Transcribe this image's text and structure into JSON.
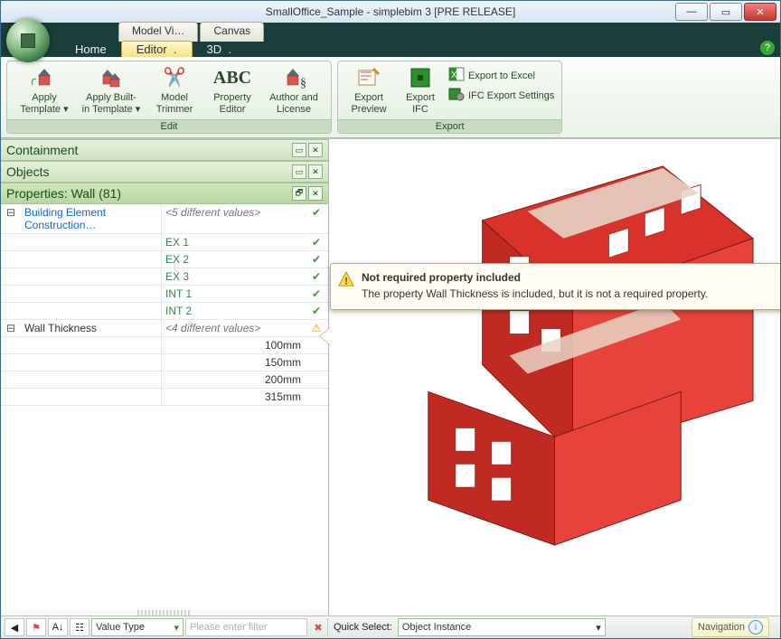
{
  "window": {
    "title": "SmallOffice_Sample - simplebim 3 [PRE RELEASE]"
  },
  "context_tabs": {
    "items": [
      "Model Vi…",
      "Canvas"
    ]
  },
  "main_tabs": {
    "items": [
      "Home",
      "Editor",
      "3D"
    ],
    "active": "Editor"
  },
  "ribbon": {
    "groups": [
      {
        "name": "Edit",
        "items": [
          {
            "label1": "Apply",
            "label2": "Template ▾",
            "icon": "apply-template-icon"
          },
          {
            "label1": "Apply Built-",
            "label2": "in Template ▾",
            "icon": "apply-builtin-template-icon"
          },
          {
            "label1": "Model",
            "label2": "Trimmer",
            "icon": "scissors-icon"
          },
          {
            "label1": "Property",
            "label2": "Editor",
            "icon": "property-editor-icon"
          },
          {
            "label1": "Author and",
            "label2": "License",
            "icon": "author-license-icon"
          }
        ]
      },
      {
        "name": "Export",
        "items": [
          {
            "label1": "Export",
            "label2": "Preview",
            "icon": "export-preview-icon"
          },
          {
            "label1": "Export",
            "label2": "IFC",
            "icon": "export-ifc-icon"
          }
        ],
        "small_items": [
          {
            "label": "Export to Excel",
            "icon": "excel-icon"
          },
          {
            "label": "IFC Export Settings",
            "icon": "ifc-settings-icon"
          }
        ]
      }
    ]
  },
  "panels": {
    "containment": {
      "title": "Containment"
    },
    "objects": {
      "title": "Objects"
    },
    "properties": {
      "title": "Properties: Wall (81)"
    }
  },
  "properties_grid": {
    "rows": [
      {
        "kind": "group",
        "name": "Building Element Construction…",
        "value": "<5 different values>",
        "status": "ok"
      },
      {
        "kind": "value",
        "value": "EX 1",
        "status": "ok"
      },
      {
        "kind": "value",
        "value": "EX 2",
        "status": "ok"
      },
      {
        "kind": "value",
        "value": "EX 3",
        "status": "ok"
      },
      {
        "kind": "value",
        "value": "INT 1",
        "status": "ok"
      },
      {
        "kind": "value",
        "value": "INT 2",
        "status": "ok"
      },
      {
        "kind": "group",
        "name": "Wall Thickness",
        "value": "<4 different values>",
        "status": "warn"
      },
      {
        "kind": "value",
        "value": "100mm",
        "status": ""
      },
      {
        "kind": "value",
        "value": "150mm",
        "status": ""
      },
      {
        "kind": "value",
        "value": "200mm",
        "status": ""
      },
      {
        "kind": "value",
        "value": "315mm",
        "status": ""
      }
    ]
  },
  "tooltip": {
    "title": "Not required property included",
    "body": "The property  Wall Thickness is included, but it is not a required property."
  },
  "statusbar": {
    "value_type_label": "Value Type",
    "filter_placeholder": "Please enter filter",
    "quick_select_label": "Quick Select:",
    "quick_select_value": "Object Instance",
    "navigation_label": "Navigation"
  },
  "colors": {
    "accent_green": "#7db87a",
    "wall_red": "#d8322a"
  }
}
